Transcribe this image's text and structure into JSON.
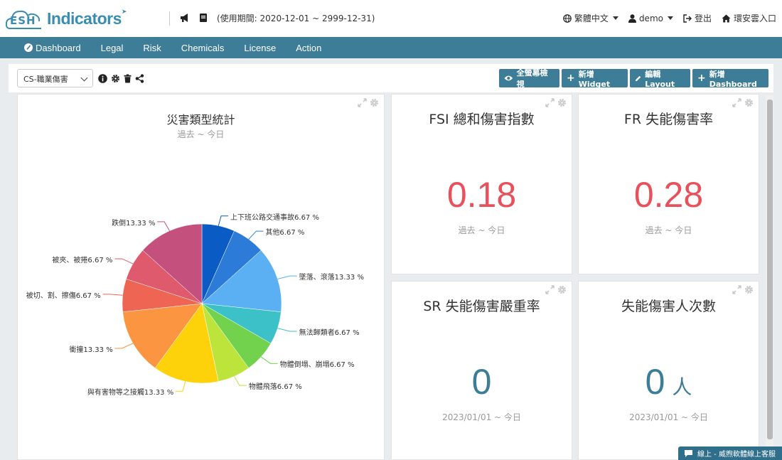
{
  "header": {
    "logo_esh": "ESH",
    "logo_word": "Indicators",
    "period": "(使用期間: 2020-12-01 ~ 2999-12-31)",
    "language": "繁體中文",
    "user": "demo",
    "logout": "登出",
    "portal": "環安雲入口"
  },
  "nav": {
    "items": [
      "Dashboard",
      "Legal",
      "Risk",
      "Chemicals",
      "License",
      "Action"
    ]
  },
  "toolbar": {
    "dashboard_select": "CS-職業傷害",
    "fullscreen": "全螢幕檢視",
    "add_widget": "新增 Widget",
    "edit_layout": "編輯 Layout",
    "add_dashboard": "新增 Dashboard"
  },
  "pie_card": {
    "title": "災害類型統計",
    "subtitle": "過去 ~ 今日"
  },
  "chart_data": {
    "type": "pie",
    "title": "災害類型統計",
    "subtitle": "過去 ~ 今日",
    "slices": [
      {
        "label": "上下班公路交通事故",
        "value": 6.67,
        "color": "#0a5bc4"
      },
      {
        "label": "其他",
        "value": 6.67,
        "color": "#2c7bd9"
      },
      {
        "label": "墜落、滾落",
        "value": 13.33,
        "color": "#5ab0f2"
      },
      {
        "label": "無法歸類者",
        "value": 6.67,
        "color": "#3cc1c9"
      },
      {
        "label": "物體倒塌、崩塌",
        "value": 6.67,
        "color": "#72d14d"
      },
      {
        "label": "物體飛落",
        "value": 6.67,
        "color": "#bde43a"
      },
      {
        "label": "與有害物等之接觸",
        "value": 13.33,
        "color": "#fdd20a"
      },
      {
        "label": "衝撞",
        "value": 13.33,
        "color": "#fb9542"
      },
      {
        "label": "被切、割、擦傷",
        "value": 6.67,
        "color": "#ee6553"
      },
      {
        "label": "被夾、被捲",
        "value": 6.67,
        "color": "#de5a6c"
      },
      {
        "label": "跌倒",
        "value": 13.33,
        "color": "#c4507e"
      }
    ],
    "unit": "%"
  },
  "kpis": [
    {
      "title": "FSI 總和傷害指數",
      "value": "0.18",
      "sub": "過去 ~ 今日",
      "color": "#e8505b",
      "unit": ""
    },
    {
      "title": "FR 失能傷害率",
      "value": "0.28",
      "sub": "過去 ~ 今日",
      "color": "#e8505b",
      "unit": ""
    },
    {
      "title": "SR 失能傷害嚴重率",
      "value": "0",
      "sub": "2023/01/01 ~ 今日",
      "color": "#3e7d98",
      "unit": ""
    },
    {
      "title": "失能傷害人次數",
      "value": "0",
      "sub": "2023/01/01 ~ 今日",
      "color": "#3e7d98",
      "unit": "人"
    }
  ],
  "chat": {
    "label": "線上 - 威煦軟體線上客服"
  }
}
